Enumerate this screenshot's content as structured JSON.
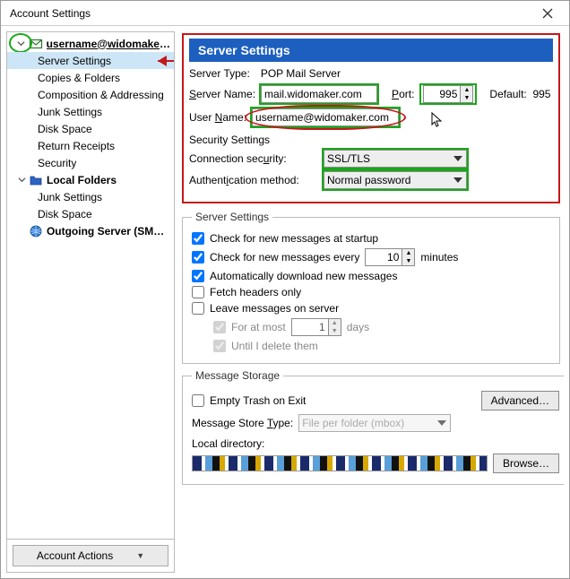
{
  "window": {
    "title": "Account Settings"
  },
  "sidebar": {
    "account_label": "username@widomaker....",
    "items": [
      "Server Settings",
      "Copies & Folders",
      "Composition & Addressing",
      "Junk Settings",
      "Disk Space",
      "Return Receipts",
      "Security"
    ],
    "local_folders_label": "Local Folders",
    "local_items": [
      "Junk Settings",
      "Disk Space"
    ],
    "outgoing_label": "Outgoing Server (SMTP)",
    "actions_label": "Account Actions"
  },
  "header": "Server Settings",
  "server": {
    "type_label_pre": "Server Type:",
    "type_value": "POP Mail Server",
    "name_label": "Server Name:",
    "name_ul": "S",
    "name_value": "mail.widomaker.com",
    "port_label": "Port:",
    "port_ul": "P",
    "port_value": "995",
    "default_label": "Default:",
    "default_value": "995",
    "user_label": "User Name:",
    "user_ul": "N",
    "user_value": "username@widomaker.com"
  },
  "security": {
    "heading": "Security Settings",
    "conn_label": "Connection security:",
    "conn_ul": "u",
    "conn_value": "SSL/TLS",
    "auth_label": "Authentication method:",
    "auth_ul": "i",
    "auth_value": "Normal password"
  },
  "settings": {
    "legend": "Server Settings",
    "check_startup": "Check for new messages at startup",
    "check_startup_ul": "C",
    "check_every_pre": "Check for new messages every",
    "check_every_ul": "y",
    "check_every_value": "10",
    "check_every_suffix": "minutes",
    "auto_dl": "Automatically download new messages",
    "auto_dl_ul": "m",
    "fetch_headers": "Fetch headers only",
    "fetch_ul": "F",
    "leave": "Leave messages on server",
    "leave_ul": "g",
    "for_at_most_pre": "For at most",
    "for_at_most_ul": "o",
    "for_at_most_value": "1",
    "for_at_most_suffix": "days",
    "until_delete": "Until I delete them",
    "until_ul": "d"
  },
  "storage": {
    "legend": "Message Storage",
    "empty_trash": "Empty Trash on Exit",
    "empty_ul": "x",
    "advanced": "Advanced…",
    "advanced_ul": "v",
    "store_type_label": "Message Store Type:",
    "store_type_ul": "T",
    "store_type_value": "File per folder (mbox)",
    "local_dir_label": "Local directory:",
    "browse": "Browse…",
    "browse_ul": "B"
  }
}
